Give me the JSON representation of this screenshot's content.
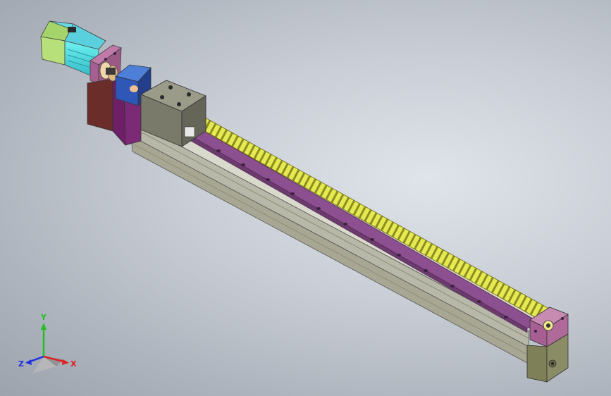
{
  "viewport": {
    "background_color": "#c9ced6"
  },
  "model": {
    "parts": [
      {
        "name": "servo-motor",
        "color": "#47e0e0"
      },
      {
        "name": "motor-flange-plate",
        "color": "#9b5a86"
      },
      {
        "name": "coupling",
        "color": "#e8c79a"
      },
      {
        "name": "gearbox",
        "color": "#2f57b8"
      },
      {
        "name": "reducer-housing",
        "color": "#6e1f68"
      },
      {
        "name": "drive-end-bearing-block",
        "color": "#7a7a6a"
      },
      {
        "name": "ball-screw",
        "color": "#e8ec55"
      },
      {
        "name": "linear-guide-rail",
        "color": "#8c4f8f"
      },
      {
        "name": "base-extrusion",
        "color": "#c6c6b8"
      },
      {
        "name": "end-support-block",
        "color": "#b06a9a"
      },
      {
        "name": "end-base-block",
        "color": "#8a8c66"
      }
    ]
  },
  "triad": {
    "x_label": "X",
    "y_label": "Y",
    "z_label": "Z",
    "x_color": "#e02020",
    "y_color": "#20c020",
    "z_color": "#2030e0"
  }
}
